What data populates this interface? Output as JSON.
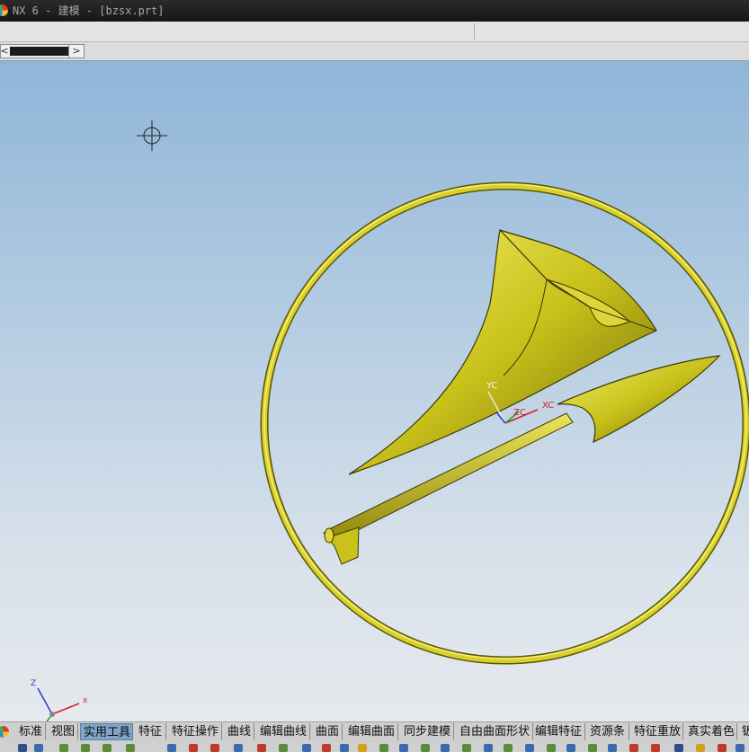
{
  "window": {
    "title": "NX 6 - 建模 - [bzsx.prt]"
  },
  "viewport": {
    "wcs_labels": {
      "yc": "YC",
      "zc": "ZC",
      "xc": "XC"
    },
    "absolute_triad": {
      "z": "Z",
      "x": "x"
    },
    "model_color": "#c9c21b",
    "background_top": "#8fb5d8",
    "background_bottom": "#e6e9ed"
  },
  "toolbar_tabs": [
    {
      "label": "标准"
    },
    {
      "label": "视图"
    },
    {
      "label": "实用工具",
      "active": true
    },
    {
      "label": "特征"
    },
    {
      "label": "特征操作"
    },
    {
      "label": "曲线"
    },
    {
      "label": "编辑曲线"
    },
    {
      "label": "曲面"
    },
    {
      "label": "编辑曲面"
    },
    {
      "label": "同步建模"
    },
    {
      "label": "自由曲面形状"
    },
    {
      "label": "编辑特征"
    },
    {
      "label": "资源条"
    },
    {
      "label": "特征重放"
    },
    {
      "label": "真实着色"
    },
    {
      "label": "钣"
    }
  ]
}
